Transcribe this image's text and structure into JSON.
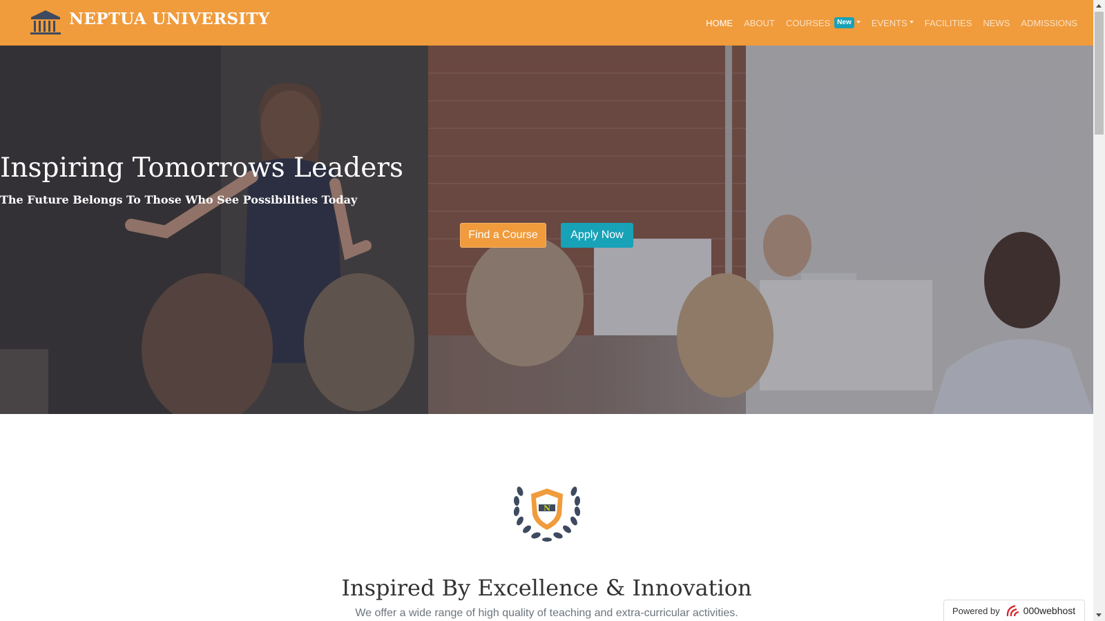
{
  "brand": {
    "name": "NEPTUA UNIVERSITY",
    "icon": "columns-building-icon"
  },
  "nav": {
    "items": [
      {
        "label": "HOME",
        "active": true
      },
      {
        "label": "ABOUT"
      },
      {
        "label": "COURSES",
        "badge": "New",
        "dropdown": true
      },
      {
        "label": "EVENTS",
        "dropdown": true
      },
      {
        "label": "FACILITIES"
      },
      {
        "label": "NEWS"
      },
      {
        "label": "ADMISSIONS"
      }
    ]
  },
  "hero": {
    "title": "Inspiring Tomorrows Leaders",
    "subtitle": "The Future Belongs To Those Who See Possibilities Today",
    "primary_button": "Find a Course",
    "secondary_button": "Apply Now"
  },
  "section": {
    "emblem_letter": "N",
    "title": "Inspired By Excellence & Innovation",
    "text": "We offer a wide range of high quality of teaching and extra-curricular activities."
  },
  "powered": {
    "prefix": "Powered by",
    "brand": "000webhost"
  },
  "colors": {
    "accent_orange": "#f09b3c",
    "accent_teal": "#17a2b8",
    "emblem_navy": "#3d4a5f"
  }
}
